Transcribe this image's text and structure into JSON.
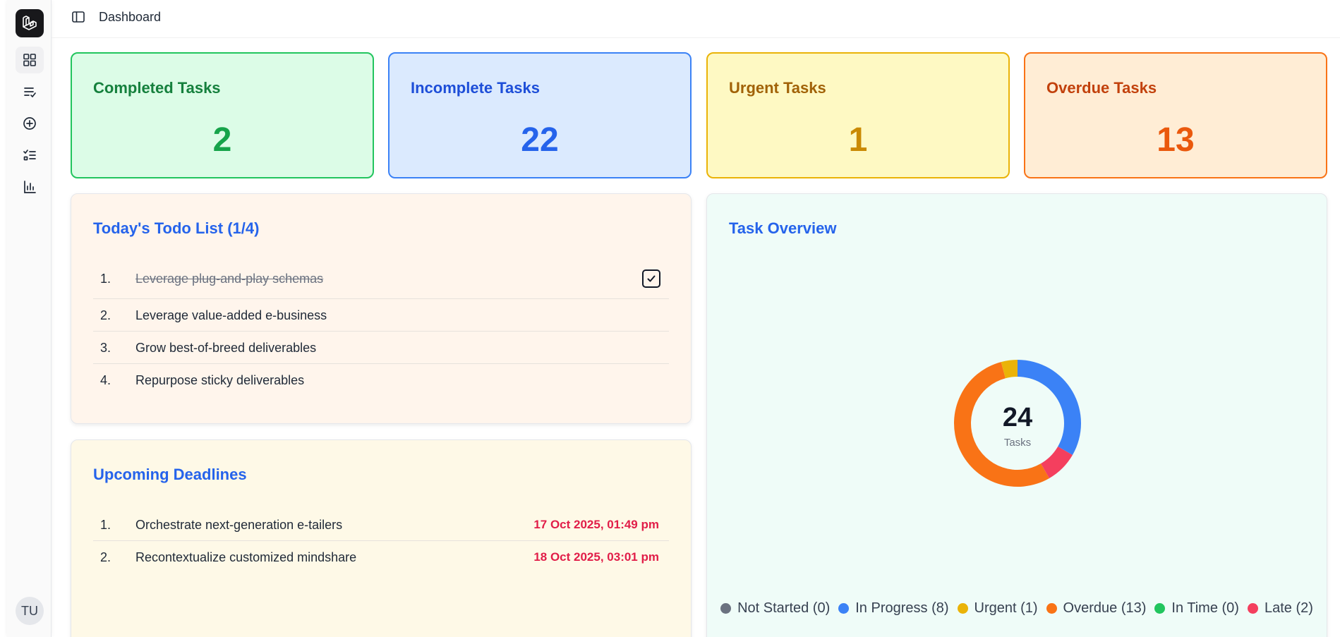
{
  "header": {
    "title": "Dashboard"
  },
  "sidebar": {
    "items": [
      {
        "icon": "dashboard-grid-icon"
      },
      {
        "icon": "task-list-icon"
      },
      {
        "icon": "add-circle-icon"
      },
      {
        "icon": "checklist-icon"
      },
      {
        "icon": "bar-chart-icon"
      }
    ],
    "avatar_initials": "TU"
  },
  "stats": [
    {
      "label": "Completed Tasks",
      "value": "2"
    },
    {
      "label": "Incomplete Tasks",
      "value": "22"
    },
    {
      "label": "Urgent Tasks",
      "value": "1"
    },
    {
      "label": "Overdue Tasks",
      "value": "13"
    }
  ],
  "todo": {
    "title": "Today's Todo List (1/4)",
    "items": [
      {
        "num": "1.",
        "text": "Leverage plug-and-play schemas",
        "done": true
      },
      {
        "num": "2.",
        "text": "Leverage value-added e-business",
        "done": false
      },
      {
        "num": "3.",
        "text": "Grow best-of-breed deliverables",
        "done": false
      },
      {
        "num": "4.",
        "text": "Repurpose sticky deliverables",
        "done": false
      }
    ]
  },
  "deadlines": {
    "title": "Upcoming Deadlines",
    "items": [
      {
        "num": "1.",
        "text": "Orchestrate next-generation e-tailers",
        "date": "17 Oct 2025, 01:49 pm"
      },
      {
        "num": "2.",
        "text": "Recontextualize customized mindshare",
        "date": "18 Oct 2025, 03:01 pm"
      }
    ]
  },
  "overview": {
    "title": "Task Overview",
    "total": "24",
    "total_label": "Tasks"
  },
  "chart_data": {
    "type": "pie",
    "categories": [
      "Not Started",
      "In Progress",
      "Urgent",
      "Overdue",
      "In Time",
      "Late"
    ],
    "values": [
      0,
      8,
      1,
      13,
      0,
      2
    ],
    "legend_labels": [
      "Not Started (0)",
      "In Progress (8)",
      "Urgent (1)",
      "Overdue (13)",
      "In Time (0)",
      "Late (2)"
    ],
    "colors": [
      "#6b7280",
      "#3b82f6",
      "#eab308",
      "#f97316",
      "#22c55e",
      "#f43f5e"
    ],
    "legend_position": "bottom"
  }
}
